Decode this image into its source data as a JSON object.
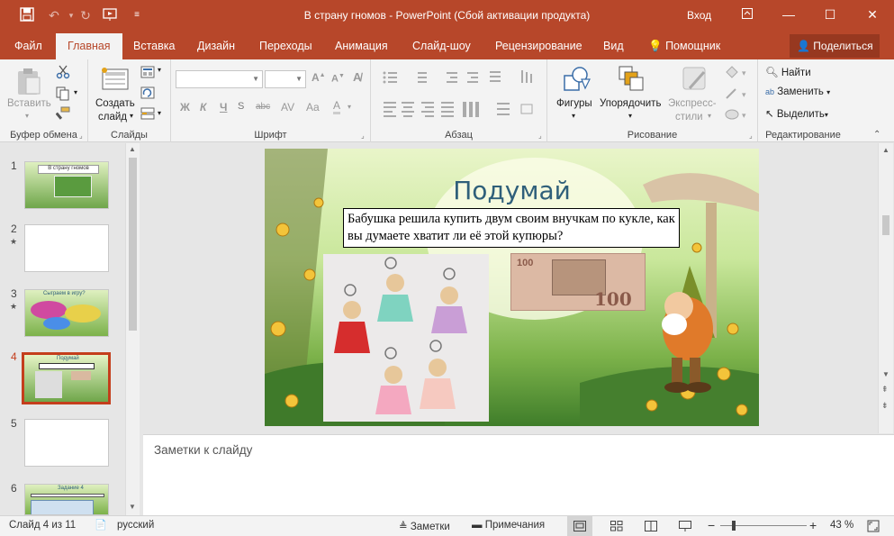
{
  "window": {
    "title": "В страну гномов  -  PowerPoint (Сбой активации продукта)",
    "login": "Вход"
  },
  "tabs": [
    {
      "label": "Файл"
    },
    {
      "label": "Главная"
    },
    {
      "label": "Вставка"
    },
    {
      "label": "Дизайн"
    },
    {
      "label": "Переходы"
    },
    {
      "label": "Анимация"
    },
    {
      "label": "Слайд-шоу"
    },
    {
      "label": "Рецензирование"
    },
    {
      "label": "Вид"
    },
    {
      "label": "Помощник"
    }
  ],
  "share": "Поделиться",
  "ribbon": {
    "clipboard": {
      "paste": "Вставить",
      "label": "Буфер обмена"
    },
    "slides": {
      "new_slide": "Создать",
      "new_slide2": "слайд",
      "label": "Слайды"
    },
    "font": {
      "label": "Шрифт",
      "name": "",
      "size": "",
      "bold": "Ж",
      "italic": "К",
      "underline": "Ч",
      "strike": "abc",
      "shadow": "S",
      "case": "Aa"
    },
    "paragraph": {
      "label": "Абзац"
    },
    "drawing": {
      "shapes": "Фигуры",
      "arrange": "Упорядочить",
      "styles": "Экспресс-",
      "styles2": "стили",
      "label": "Рисование"
    },
    "editing": {
      "find": "Найти",
      "replace": "Заменить",
      "select": "Выделить",
      "label": "Редактирование"
    }
  },
  "thumbnails": [
    {
      "num": "1",
      "star": "",
      "title": "В страну гномов"
    },
    {
      "num": "2",
      "star": "★",
      "title": ""
    },
    {
      "num": "3",
      "star": "★",
      "title": "Сыграем в игру?"
    },
    {
      "num": "4",
      "star": "",
      "title": "Подумай"
    },
    {
      "num": "5",
      "star": "",
      "title": ""
    },
    {
      "num": "6",
      "star": "",
      "title": "Задание 4"
    }
  ],
  "slide": {
    "title": "Подумай",
    "text": "Бабушка решила купить двум своим внучкам по кукле, как вы думаете хватит ли её этой купюры?",
    "banknote_value": "100"
  },
  "notes_placeholder": "Заметки к слайду",
  "status": {
    "slide": "Слайд 4 из 11",
    "language": "русский",
    "notes": "Заметки",
    "comments": "Примечания",
    "zoom": "43 %"
  },
  "colors": {
    "accent": "#b7472a",
    "selected": "#c43e1c",
    "title": "#2f5f7a"
  }
}
